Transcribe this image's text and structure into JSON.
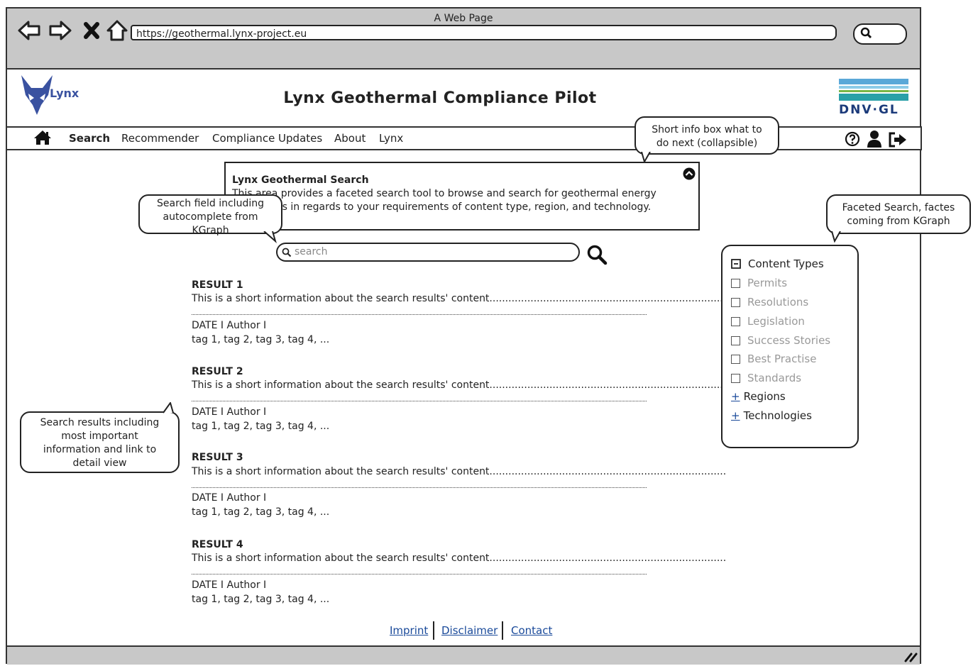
{
  "browser": {
    "window_title": "A Web Page",
    "url": "https://geothermal.lynx-project.eu"
  },
  "header": {
    "logo_text": "Lynx",
    "site_title": "Lynx Geothermal Compliance Pilot",
    "partner_logo": "DNV·GL"
  },
  "nav": {
    "items": [
      "Search",
      "Recommender",
      "Compliance Updates",
      "About",
      "Lynx"
    ],
    "active": "Search"
  },
  "infobox": {
    "title": "Lynx Geothermal Search",
    "line1": "This area provides a faceted search tool to browse and search for geothermal energy",
    "line2": "documents in regards to your requirements of content type, region, and technology."
  },
  "callouts": {
    "info": [
      "Short info box what to",
      "do next (collapsible)"
    ],
    "search": [
      "Search field including",
      "autocomplete from",
      "KGraph"
    ],
    "facets": [
      "Faceted Search, factes",
      "coming from KGraph"
    ],
    "results": [
      "Search results including",
      "most important",
      "information and link to",
      "detail view"
    ]
  },
  "search": {
    "placeholder": "search"
  },
  "results": [
    {
      "title": "RESULT 1",
      "desc": "This is a short information about the search results' content...........................................................................",
      "meta": "DATE I Author I",
      "tags": "tag 1, tag 2, tag 3, tag 4, ..."
    },
    {
      "title": "RESULT 2",
      "desc": "This is a short information about the search results' content...........................................................................",
      "meta": "DATE I Author I",
      "tags": "tag 1, tag 2, tag 3, tag 4, ..."
    },
    {
      "title": "RESULT 3",
      "desc": "This is a short information about the search results' content...........................................................................",
      "meta": "DATE I Author I",
      "tags": "tag 1, tag 2, tag 3, tag 4, ..."
    },
    {
      "title": "RESULT 4",
      "desc": "This is a short information about the search results' content...........................................................................",
      "meta": "DATE I Author I",
      "tags": "tag 1, tag 2, tag 3, tag 4, ..."
    }
  ],
  "facets": {
    "group_label": "Content Types",
    "items": [
      "Permits",
      "Resolutions",
      "Legislation",
      "Success Stories",
      "Best Practise",
      "Standards"
    ],
    "collapsed": [
      "Regions",
      "Technologies"
    ]
  },
  "footer": {
    "links": [
      "Imprint",
      "Disclaimer",
      "Contact"
    ]
  },
  "colors": {
    "chrome_gray": "#c8c8c8",
    "logo_blue": "#3a52a0",
    "dnv_teal": "#2aa0a8",
    "dnv_green": "#7ab648",
    "link_blue": "#1a4a9a"
  }
}
